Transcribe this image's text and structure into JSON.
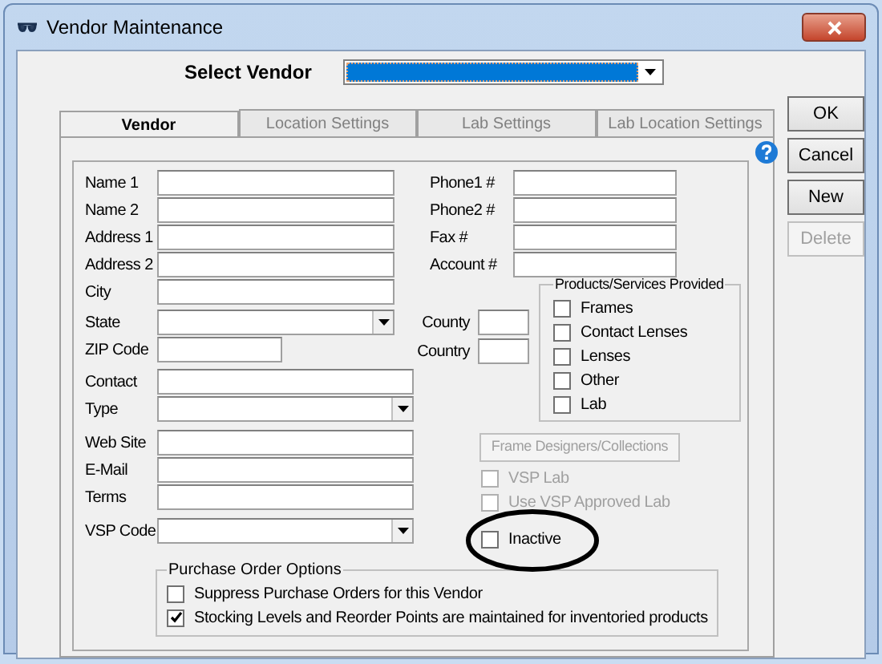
{
  "window": {
    "title": "Vendor Maintenance"
  },
  "select_vendor": {
    "label": "Select Vendor",
    "focused": true
  },
  "tabs": [
    {
      "label": "Vendor",
      "selected": true
    },
    {
      "label": "Location Settings",
      "selected": false
    },
    {
      "label": "Lab Settings",
      "selected": false
    },
    {
      "label": "Lab Location Settings",
      "selected": false
    }
  ],
  "buttons": [
    {
      "label": "OK",
      "disabled": false
    },
    {
      "label": "Cancel",
      "disabled": false
    },
    {
      "label": "New",
      "disabled": false
    },
    {
      "label": "Delete",
      "disabled": true
    }
  ],
  "contact_fields": [
    {
      "label": "Name 1"
    },
    {
      "label": "Name 2"
    },
    {
      "label": "Address 1"
    },
    {
      "label": "Address 2"
    }
  ],
  "phone_fields": [
    {
      "label": "Phone1 #"
    },
    {
      "label": "Phone2 #"
    },
    {
      "label": "Fax #"
    },
    {
      "label": "Account #"
    }
  ],
  "detail_fields": [
    {
      "label": "City",
      "kind": "text"
    },
    {
      "label": "State",
      "kind": "dropdown"
    },
    {
      "label": "ZIP Code",
      "kind": "short"
    },
    {
      "label": "Contact",
      "kind": "wide"
    },
    {
      "label": "Type",
      "kind": "wide-dropdown"
    },
    {
      "label": "Web Site",
      "kind": "wide"
    },
    {
      "label": "E-Mail",
      "kind": "wide"
    },
    {
      "label": "Terms",
      "kind": "wide"
    },
    {
      "label": "VSP Code",
      "kind": "wide-dropdown"
    }
  ],
  "region_fields": [
    {
      "label": "County"
    },
    {
      "label": "Country"
    }
  ],
  "products": {
    "title": "Products/Services Provided",
    "items": [
      {
        "label": "Frames",
        "checked": false
      },
      {
        "label": "Contact Lenses",
        "checked": false
      },
      {
        "label": "Lenses",
        "checked": false
      },
      {
        "label": "Other",
        "checked": false
      },
      {
        "label": "Lab",
        "checked": false
      }
    ]
  },
  "frame_button": {
    "label": "Frame Designers/Collections",
    "disabled": true
  },
  "vsp_options": [
    {
      "label": "VSP Lab",
      "checked": false,
      "disabled": true
    },
    {
      "label": "Use VSP Approved Lab",
      "checked": false,
      "disabled": true
    }
  ],
  "inactive": {
    "label": "Inactive",
    "checked": false
  },
  "purchase_order_options": {
    "title": "Purchase Order Options",
    "items": [
      {
        "label": "Suppress Purchase Orders for this Vendor",
        "checked": false
      },
      {
        "label": "Stocking Levels and Reorder Points are maintained for inventoried products",
        "checked": true
      }
    ]
  }
}
